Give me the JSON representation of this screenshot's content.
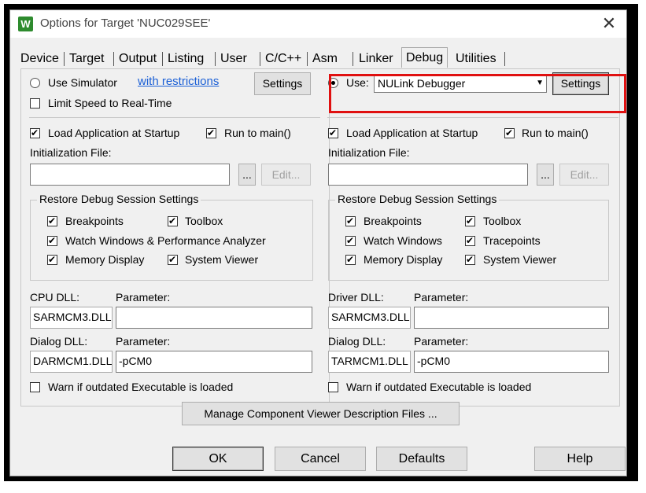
{
  "window": {
    "title": "Options for Target 'NUC029SEE'",
    "icon_letter": "W",
    "close_glyph": "✕"
  },
  "tabs": [
    "Device",
    "Target",
    "Output",
    "Listing",
    "User",
    "C/C++",
    "Asm",
    "Linker",
    "Debug",
    "Utilities"
  ],
  "active_tab": "Debug",
  "left": {
    "use_simulator_label": "Use Simulator",
    "restrictions_link": "with restrictions",
    "settings_label": "Settings",
    "limit_speed_label": "Limit Speed to Real-Time",
    "load_app_label": "Load Application at Startup",
    "run_to_main_label": "Run to main()",
    "init_file_label": "Initialization File:",
    "init_file_value": "",
    "browse_label": "...",
    "edit_label": "Edit...",
    "restore_group_title": "Restore Debug Session Settings",
    "breakpoints_label": "Breakpoints",
    "toolbox_label": "Toolbox",
    "watch_label": "Watch Windows & Performance Analyzer",
    "memory_label": "Memory Display",
    "system_viewer_label": "System Viewer",
    "cpu_dll_label": "CPU DLL:",
    "cpu_param_label": "Parameter:",
    "cpu_dll_value": "SARMCM3.DLL",
    "cpu_param_value": "",
    "dialog_dll_label": "Dialog DLL:",
    "dialog_param_label": "Parameter:",
    "dialog_dll_value": "DARMCM1.DLL",
    "dialog_param_value": "-pCM0",
    "warn_label": "Warn if outdated Executable is loaded"
  },
  "right": {
    "use_label": "Use:",
    "debugger_value": "NULink Debugger",
    "settings_label": "Settings",
    "load_app_label": "Load Application at Startup",
    "run_to_main_label": "Run to main()",
    "init_file_label": "Initialization File:",
    "init_file_value": "",
    "browse_label": "...",
    "edit_label": "Edit...",
    "restore_group_title": "Restore Debug Session Settings",
    "breakpoints_label": "Breakpoints",
    "toolbox_label": "Toolbox",
    "watch_label": "Watch Windows",
    "tracepoints_label": "Tracepoints",
    "memory_label": "Memory Display",
    "system_viewer_label": "System Viewer",
    "driver_dll_label": "Driver DLL:",
    "driver_param_label": "Parameter:",
    "driver_dll_value": "SARMCM3.DLL",
    "driver_param_value": "",
    "dialog_dll_label": "Dialog DLL:",
    "dialog_param_label": "Parameter:",
    "dialog_dll_value": "TARMCM1.DLL",
    "dialog_param_value": "-pCM0",
    "warn_label": "Warn if outdated Executable is loaded"
  },
  "manage_label": "Manage Component Viewer Description Files ...",
  "footer": {
    "ok_label": "OK",
    "cancel_label": "Cancel",
    "defaults_label": "Defaults",
    "help_label": "Help"
  },
  "colors": {
    "highlight": "#e01010",
    "link": "#1a5fd6"
  }
}
